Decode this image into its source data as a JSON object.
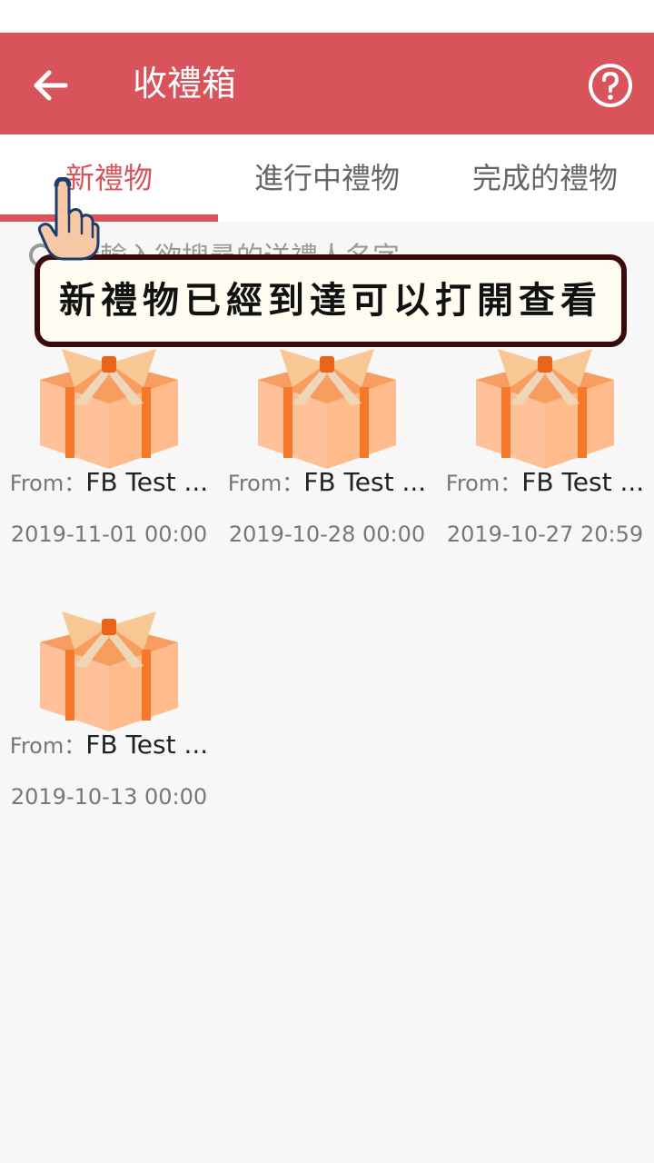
{
  "header": {
    "title": "收禮箱",
    "back_icon": "back-arrow-icon",
    "help_icon": "question-circle-icon"
  },
  "tabs": [
    {
      "label": "新禮物",
      "active": true
    },
    {
      "label": "進行中禮物",
      "active": false
    },
    {
      "label": "完成的禮物",
      "active": false
    }
  ],
  "search": {
    "placeholder": "請輸入欲搜尋的送禮人名字"
  },
  "tip": {
    "text": "新禮物已經到達可以打開查看"
  },
  "gifts": [
    {
      "from_label": "From：",
      "from_name": "FB Test ...",
      "date": "2019-11-01 00:00"
    },
    {
      "from_label": "From：",
      "from_name": "FB Test ...",
      "date": "2019-10-28 00:00"
    },
    {
      "from_label": "From：",
      "from_name": "FB Test ...",
      "date": "2019-10-27 20:59"
    },
    {
      "from_label": "From：",
      "from_name": "FB Test ...",
      "date": "2019-10-13 00:00"
    }
  ],
  "colors": {
    "accent": "#d9535a",
    "gift_box": "#ffb98a",
    "gift_ribbon": "#f7782a",
    "gift_bow": "#f7c893"
  }
}
